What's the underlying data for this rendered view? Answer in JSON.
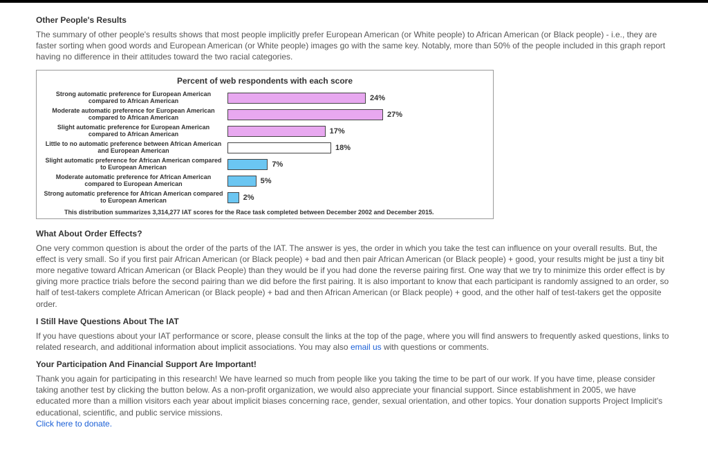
{
  "section1": {
    "heading": "Other People's Results",
    "body": "The summary of other people's results shows that most people implicitly prefer European American (or White people) to African American (or Black people) - i.e., they are faster sorting when good words and European American (or White people) images go with the same key. Notably, more than 50% of the people included in this graph report having no difference in their attitudes toward the two racial categories."
  },
  "chart_data": {
    "type": "bar",
    "title": "Percent of web respondents with each score",
    "categories": [
      "Strong automatic preference for European American compared to African American",
      "Moderate automatic preference for European American compared to African American",
      "Slight automatic preference for European American compared to African American",
      "Little to no automatic preference between African American and European American",
      "Slight automatic preference for African American compared to European American",
      "Moderate automatic preference for African American compared to European American",
      "Strong automatic preference for African American compared to European American"
    ],
    "values": [
      24,
      27,
      17,
      18,
      7,
      5,
      2
    ],
    "colors": [
      "#e8a8f0",
      "#e8a8f0",
      "#e8a8f0",
      "#ffffff",
      "#6bc6f2",
      "#6bc6f2",
      "#6bc6f2"
    ],
    "xlabel": "",
    "ylabel": "",
    "ylim": [
      0,
      30
    ],
    "footnote": "This distribution summarizes 3,314,277 IAT scores for the Race task completed between December 2002 and December 2015."
  },
  "section2": {
    "heading": "What About Order Effects?",
    "body": "One very common question is about the order of the parts of the IAT. The answer is yes, the order in which you take the test can influence on your overall results. But, the effect is very small. So if you first pair African American (or Black people) + bad and then pair African American (or Black people) + good, your results might be just a tiny bit more negative toward African American (or Black People) than they would be if you had done the reverse pairing first. One way that we try to minimize this order effect is by giving more practice trials before the second pairing than we did before the first pairing. It is also important to know that each participant is randomly assigned to an order, so half of test-takers complete African American (or Black people) + bad and then African American (or Black people) + good, and the other half of test-takers get the opposite order."
  },
  "section3": {
    "heading": "I Still Have Questions About The IAT",
    "body_before": "If you have questions about your IAT performance or score, please consult the links at the top of the page, where you will find answers to frequently asked questions, links to related research, and additional information about implicit associations. You may also ",
    "link": "email us",
    "body_after": " with questions or comments."
  },
  "section4": {
    "heading": "Your Participation And Financial Support Are Important!",
    "body": "Thank you again for participating in this research! We have learned so much from people like you taking the time to be part of our work. If you have time, please consider taking another test by clicking the button below. As a non-profit organization, we would also appreciate your financial support. Since establishment in 2005, we have educated more than a million visitors each year about implicit biases concerning race, gender, sexual orientation, and other topics. Your donation supports Project Implicit's educational, scientific, and public service missions. ",
    "link": "Click here to donate."
  }
}
